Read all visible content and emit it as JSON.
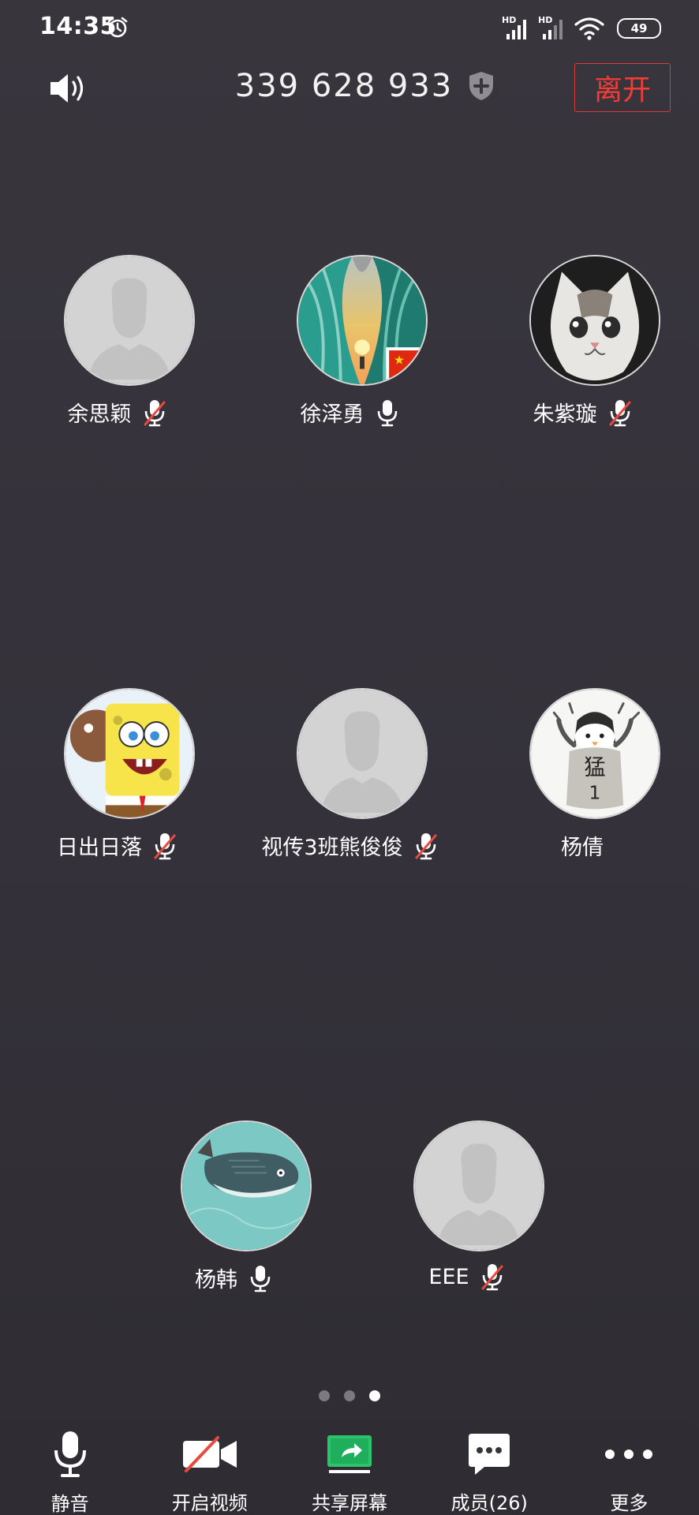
{
  "status_bar": {
    "time": "14:35",
    "battery": "49",
    "signal_1_label": "HD",
    "signal_2_label": "HD"
  },
  "header": {
    "meeting_id": "339 628 933",
    "leave_label": "离开"
  },
  "participants": [
    {
      "name": "余思颖",
      "mic": "muted",
      "avatar": "default"
    },
    {
      "name": "徐泽勇",
      "mic": "on",
      "avatar": "scenic"
    },
    {
      "name": "朱紫璇",
      "mic": "muted",
      "avatar": "cat"
    },
    {
      "name": "日出日落",
      "mic": "muted",
      "avatar": "spongebob"
    },
    {
      "name": "视传3班熊俊俊",
      "mic": "muted",
      "avatar": "default"
    },
    {
      "name": "杨倩",
      "mic": "none",
      "avatar": "penguin"
    },
    {
      "name": "杨韩",
      "mic": "on",
      "avatar": "whale"
    },
    {
      "name": "EEE",
      "mic": "muted",
      "avatar": "default"
    }
  ],
  "penguin_text": {
    "line1": "猛",
    "line2": "1"
  },
  "pagination": {
    "total": 3,
    "current": 3
  },
  "toolbar": {
    "mute_label": "静音",
    "video_label": "开启视频",
    "share_label": "共享屏幕",
    "members_label": "成员(26)",
    "more_label": "更多"
  },
  "colors": {
    "background": "#35323a",
    "leave_red": "#f23c35",
    "share_green": "#2bc46b",
    "muted_red": "#e84a3f"
  }
}
